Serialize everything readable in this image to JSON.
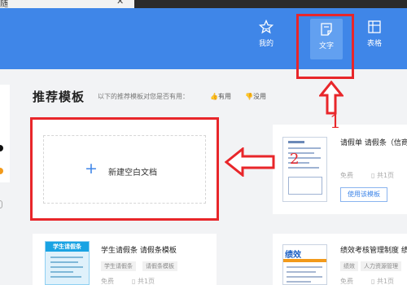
{
  "tab": {
    "title": "随",
    "close_glyph": "✕"
  },
  "topnav": {
    "items": [
      {
        "label": "我的",
        "icon": "star-icon"
      },
      {
        "label": "文字",
        "icon": "document-icon"
      },
      {
        "label": "表格",
        "icon": "table-icon"
      }
    ]
  },
  "section": {
    "title": "推荐模板",
    "subtitle": "以下的推荐模板对您是否有用：",
    "vote_yes": "有用",
    "vote_no": "没用"
  },
  "new_blank": {
    "plus": "+",
    "label": "新建空白文档"
  },
  "templates": [
    {
      "title": "请假单 请假条（信商",
      "free": "免费",
      "pages": "共1页",
      "action": "使用该模板"
    },
    {
      "title": "学生请假条 请假条模板",
      "thumb_title": "学生请假条",
      "tags": [
        "学生请假条",
        "请假条模板"
      ],
      "free": "免费",
      "pages": "共1页"
    },
    {
      "title": "绩效考核管理制度 绩",
      "thumb_title": "绩效",
      "tags": [
        "绩效",
        "人力资源管理"
      ],
      "free": "免费",
      "pages": "共1页"
    }
  ],
  "annotations": {
    "step1": "1",
    "step2": "2"
  },
  "colors": {
    "header_blue": "#3f86e8",
    "highlight_red": "#e8262a",
    "accent_orange": "#f29a1b"
  }
}
